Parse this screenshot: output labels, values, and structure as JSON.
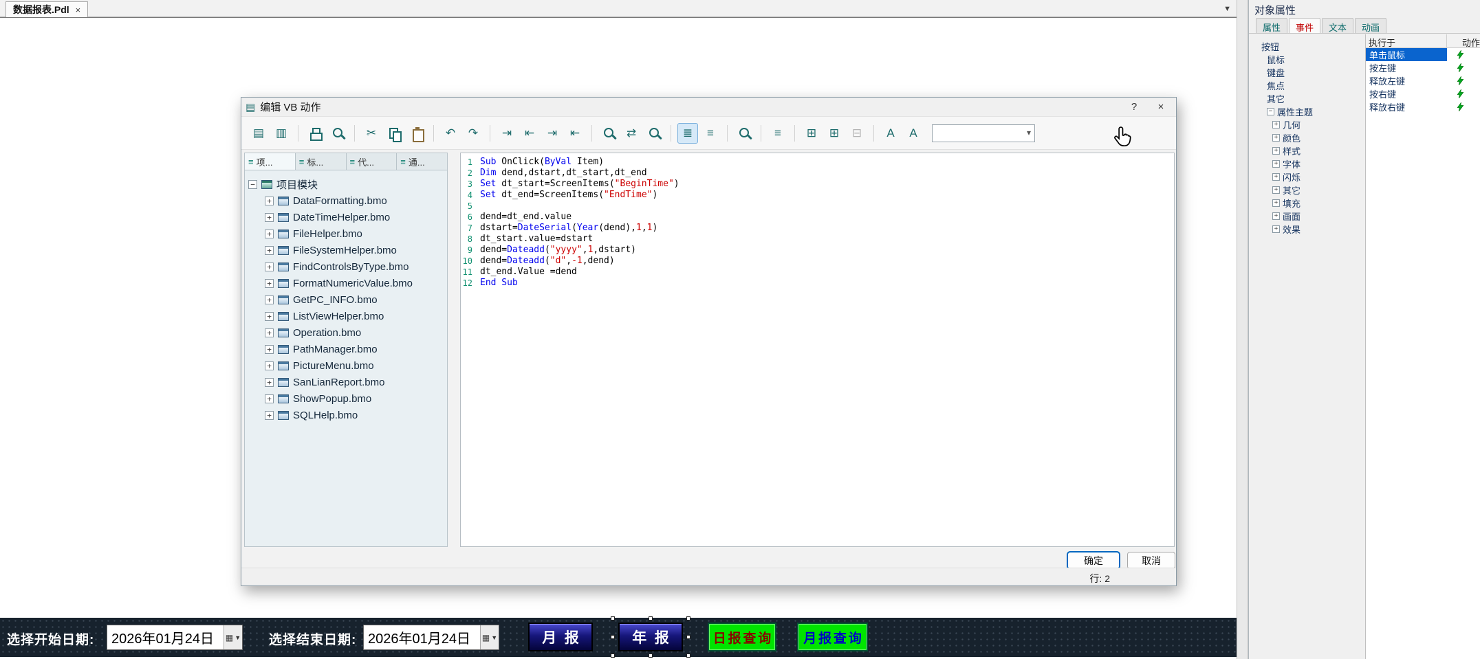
{
  "colors": {
    "selection_blue": "#0a64ce",
    "keyword_blue": "#0000ee",
    "literal_red": "#cc0000",
    "line_number_green": "#0f9070",
    "toolbar_teal": "#1d6b6b",
    "event_tab_red": "#c00000",
    "hmi_green": "#00e400",
    "hmi_blue": "#16167a",
    "hmi_bar_bg": "#17222d"
  },
  "tabbar": {
    "document_tab": "数据报表.Pdl",
    "close_icon": "×",
    "dropdown_icon": "▼"
  },
  "dialog": {
    "title": "编辑 VB 动作",
    "help_icon": "?",
    "close_icon": "×",
    "toolbar": {
      "search_value": "",
      "items": [
        {
          "name": "new-form-icon",
          "glyph": "▤"
        },
        {
          "name": "code-view-icon",
          "glyph": "▥"
        },
        {
          "sep": true
        },
        {
          "name": "print-icon",
          "css": "ic-print"
        },
        {
          "name": "print-preview-icon",
          "css": "ic-mag"
        },
        {
          "sep": true
        },
        {
          "name": "cut-icon",
          "glyph": "✂"
        },
        {
          "name": "copy-icon",
          "css": "ic-copy"
        },
        {
          "name": "paste-icon",
          "css": "ic-paste"
        },
        {
          "sep": true
        },
        {
          "name": "undo-icon",
          "glyph": "↶"
        },
        {
          "name": "redo-icon",
          "glyph": "↷"
        },
        {
          "sep": true
        },
        {
          "name": "indent-right-icon",
          "glyph": "⇥"
        },
        {
          "name": "indent-left-icon",
          "glyph": "⇤"
        },
        {
          "name": "block-indent-icon",
          "glyph": "⇥"
        },
        {
          "name": "block-outdent-icon",
          "glyph": "⇤"
        },
        {
          "sep": true
        },
        {
          "name": "find-icon",
          "css": "ic-mag"
        },
        {
          "name": "replace-icon",
          "glyph": "⇄"
        },
        {
          "name": "find-next-icon",
          "css": "ic-mag"
        },
        {
          "sep": true
        },
        {
          "name": "line-numbers-icon",
          "glyph": "≣",
          "active": true
        },
        {
          "name": "outline-icon",
          "glyph": "≡"
        },
        {
          "sep": true
        },
        {
          "name": "zoom-icon",
          "css": "ic-mag"
        },
        {
          "sep": true
        },
        {
          "name": "align-icon",
          "glyph": "≡"
        },
        {
          "sep": true
        },
        {
          "name": "insert-row-above-icon",
          "glyph": "⊞"
        },
        {
          "name": "insert-row-below-icon",
          "glyph": "⊞"
        },
        {
          "name": "delete-row-icon",
          "glyph": "⊟",
          "disabled": true
        },
        {
          "sep": true
        },
        {
          "name": "font-check-icon",
          "glyph": "A"
        },
        {
          "name": "font-settings-icon",
          "glyph": "A"
        }
      ]
    },
    "left_tabs": [
      {
        "label": "项...",
        "icon": "list-icon",
        "active": true
      },
      {
        "label": "标...",
        "icon": "list-icon"
      },
      {
        "label": "代...",
        "icon": "list-icon"
      },
      {
        "label": "通...",
        "icon": "list-icon"
      }
    ],
    "tree": {
      "root": "项目模块",
      "items": [
        "DataFormatting.bmo",
        "DateTimeHelper.bmo",
        "FileHelper.bmo",
        "FileSystemHelper.bmo",
        "FindControlsByType.bmo",
        "FormatNumericValue.bmo",
        "GetPC_INFO.bmo",
        "ListViewHelper.bmo",
        "Operation.bmo",
        "PathManager.bmo",
        "PictureMenu.bmo",
        "SanLianReport.bmo",
        "ShowPopup.bmo",
        "SQLHelp.bmo"
      ]
    },
    "editor": {
      "lines": [
        {
          "num": 1,
          "tokens": [
            [
              "Sub",
              "k"
            ],
            [
              " OnClick(",
              "p"
            ],
            [
              "ByVal",
              "k"
            ],
            [
              " Item)",
              "p"
            ]
          ]
        },
        {
          "num": 2,
          "tokens": [
            [
              "Dim",
              "k"
            ],
            [
              " dend,dstart,dt_start,dt_end",
              "p"
            ]
          ]
        },
        {
          "num": 3,
          "tokens": [
            [
              "Set",
              "k"
            ],
            [
              " dt_start=ScreenItems(",
              "p"
            ],
            [
              "\"BeginTime\"",
              "s"
            ],
            [
              ")",
              "p"
            ]
          ]
        },
        {
          "num": 4,
          "tokens": [
            [
              "Set",
              "k"
            ],
            [
              " dt_end=ScreenItems(",
              "p"
            ],
            [
              "\"EndTime\"",
              "s"
            ],
            [
              ")",
              "p"
            ]
          ]
        },
        {
          "num": 5,
          "tokens": []
        },
        {
          "num": 6,
          "tokens": [
            [
              "dend=dt_end.value",
              "p"
            ]
          ]
        },
        {
          "num": 7,
          "tokens": [
            [
              "dstart=",
              "p"
            ],
            [
              "DateSerial",
              "k"
            ],
            [
              "(",
              "p"
            ],
            [
              "Year",
              "k"
            ],
            [
              "(dend),",
              "p"
            ],
            [
              "1",
              "n"
            ],
            [
              ",",
              "p"
            ],
            [
              "1",
              "n"
            ],
            [
              ")",
              "p"
            ]
          ]
        },
        {
          "num": 8,
          "tokens": [
            [
              "dt_start.value=dstart",
              "p"
            ]
          ]
        },
        {
          "num": 9,
          "tokens": [
            [
              "dend=",
              "p"
            ],
            [
              "Dateadd",
              "k"
            ],
            [
              "(",
              "p"
            ],
            [
              "\"yyyy\"",
              "s"
            ],
            [
              ",",
              "p"
            ],
            [
              "1",
              "n"
            ],
            [
              ",dstart)",
              "p"
            ]
          ]
        },
        {
          "num": 10,
          "tokens": [
            [
              "dend=",
              "p"
            ],
            [
              "Dateadd",
              "k"
            ],
            [
              "(",
              "p"
            ],
            [
              "\"d\"",
              "s"
            ],
            [
              ",",
              "p"
            ],
            [
              "-1",
              "n"
            ],
            [
              ",dend)",
              "p"
            ]
          ]
        },
        {
          "num": 11,
          "tokens": [
            [
              "dt_end.Value =dend",
              "p"
            ]
          ]
        },
        {
          "num": 12,
          "tokens": [
            [
              "End Sub",
              "k"
            ]
          ]
        }
      ]
    },
    "buttons": {
      "ok": "确定",
      "cancel": "取消"
    },
    "status": {
      "line_indicator": "行: 2"
    }
  },
  "properties_panel": {
    "title": "对象属性",
    "tabs": [
      {
        "label": "属性"
      },
      {
        "label": "事件",
        "active": true
      },
      {
        "label": "文本"
      },
      {
        "label": "动画"
      }
    ],
    "tree": {
      "root": "按钮",
      "event_children": [
        "鼠标",
        "键盘",
        "焦点",
        "其它"
      ],
      "theme": {
        "label": "属性主题",
        "children": [
          "几何",
          "颜色",
          "样式",
          "字体",
          "闪烁",
          "其它",
          "填充",
          "画面",
          "效果"
        ]
      }
    },
    "events": {
      "header_execute": "执行于",
      "header_action": "动作",
      "rows": [
        {
          "label": "单击鼠标",
          "selected": true,
          "icon": "lightning-icon"
        },
        {
          "label": "按左键",
          "icon": "lightning-icon"
        },
        {
          "label": "释放左键",
          "icon": "lightning-icon"
        },
        {
          "label": "按右键",
          "icon": "lightning-icon"
        },
        {
          "label": "释放右键",
          "icon": "lightning-icon"
        }
      ]
    }
  },
  "bottom_bar": {
    "start_label": "选择开始日期:",
    "start_date": "2026年01月24日",
    "end_label": "选择结束日期:",
    "end_date": "2026年01月24日",
    "calendar_icon": "▦",
    "dropdown_icon": "▼",
    "buttons": {
      "monthly_report": "月报",
      "annual_report": "年报",
      "daily_query": "日报查询",
      "monthly_query": "月报查询"
    }
  }
}
